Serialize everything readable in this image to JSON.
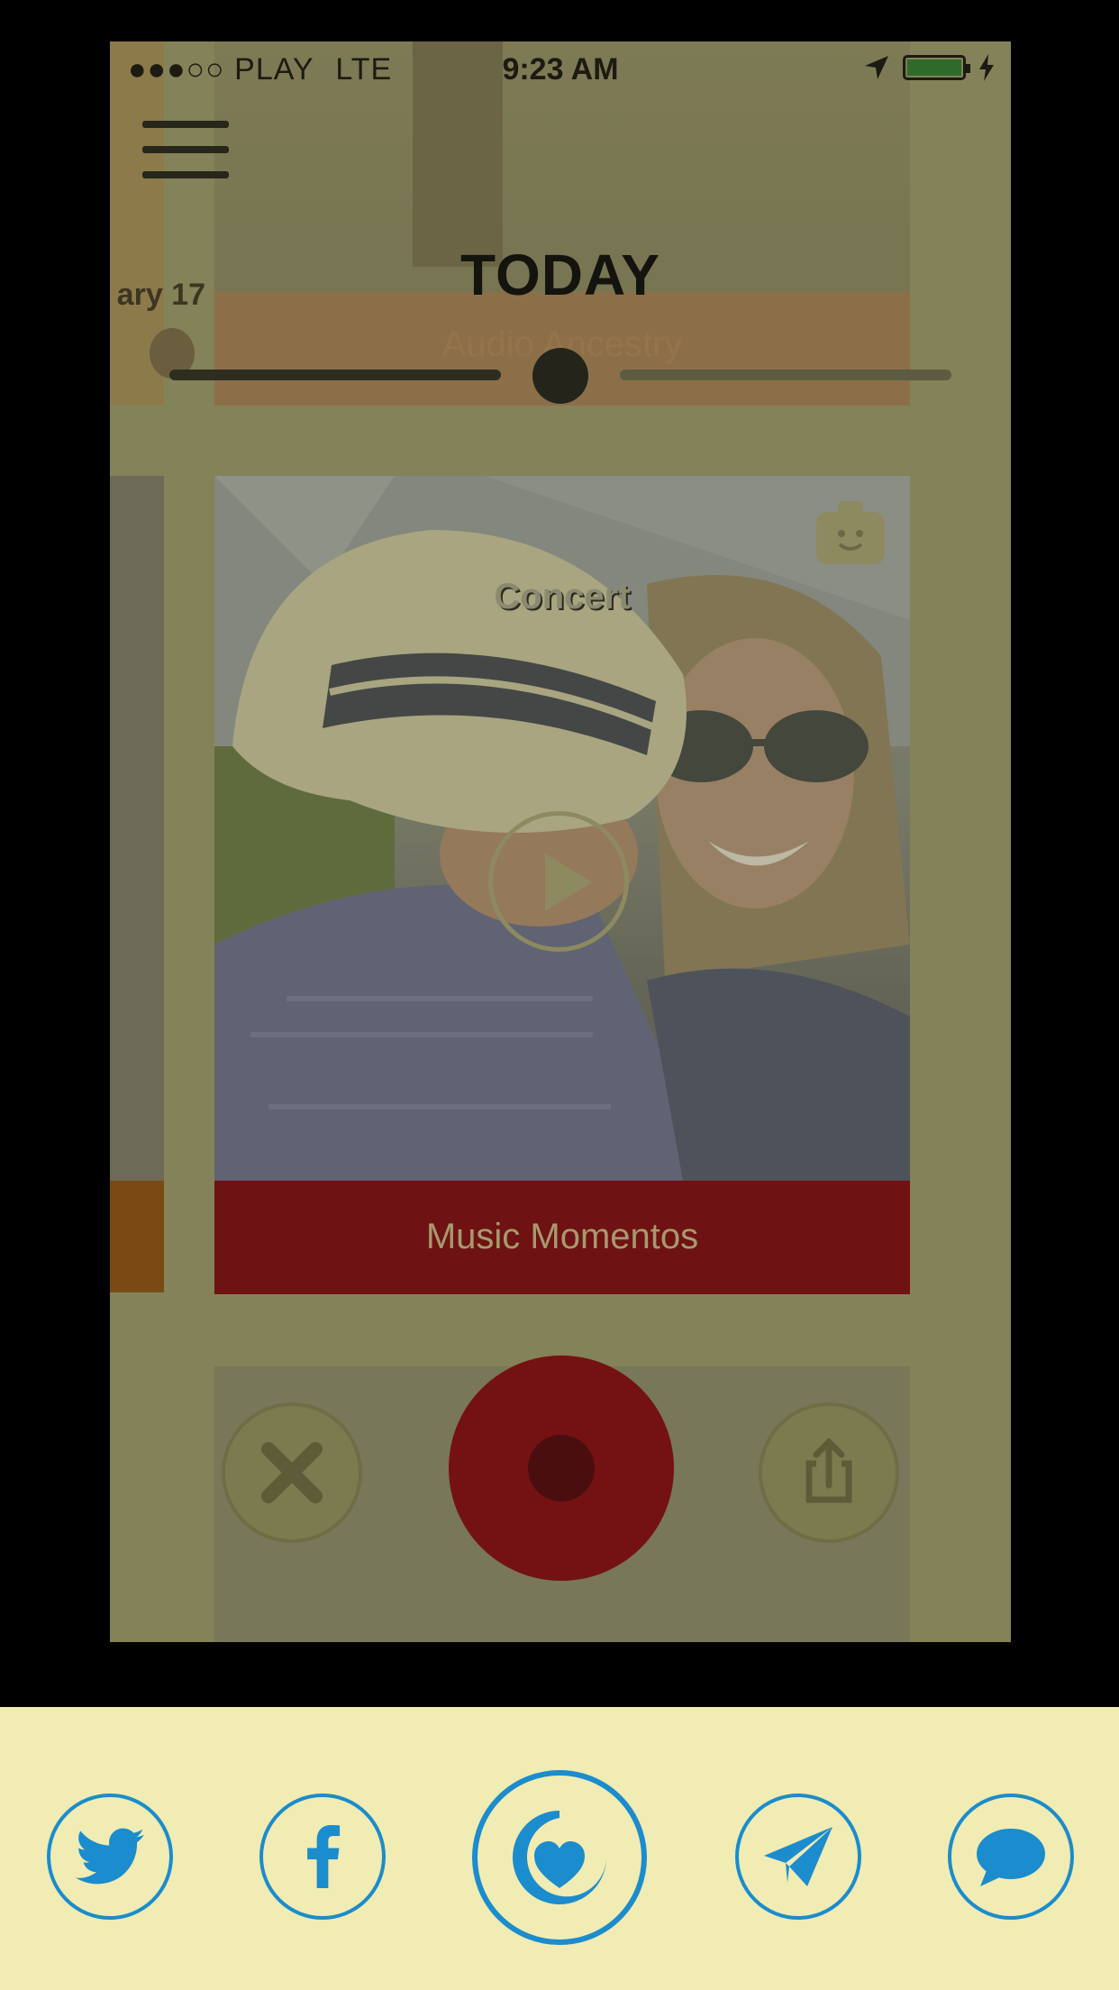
{
  "status_bar": {
    "signal": "●●●○○",
    "carrier": "PLAY",
    "network": "LTE",
    "time": "9:23 AM"
  },
  "header": {
    "title": "TODAY"
  },
  "background_cards": {
    "previous_date": "ary 17",
    "top_band": "Audio Ancestry"
  },
  "timeline_slider": {
    "position": 0.5
  },
  "main_card": {
    "caption": "Concert",
    "band_label": "Music Momentos"
  },
  "actions": {
    "cancel_icon": "close-icon",
    "record_icon": "record-icon",
    "share_icon": "share-icon"
  },
  "share_sheet": {
    "accent_color": "#1b8ccd",
    "background_color": "#f0ecb3",
    "targets": [
      "twitter",
      "facebook",
      "app-heart",
      "telegram",
      "message"
    ]
  }
}
